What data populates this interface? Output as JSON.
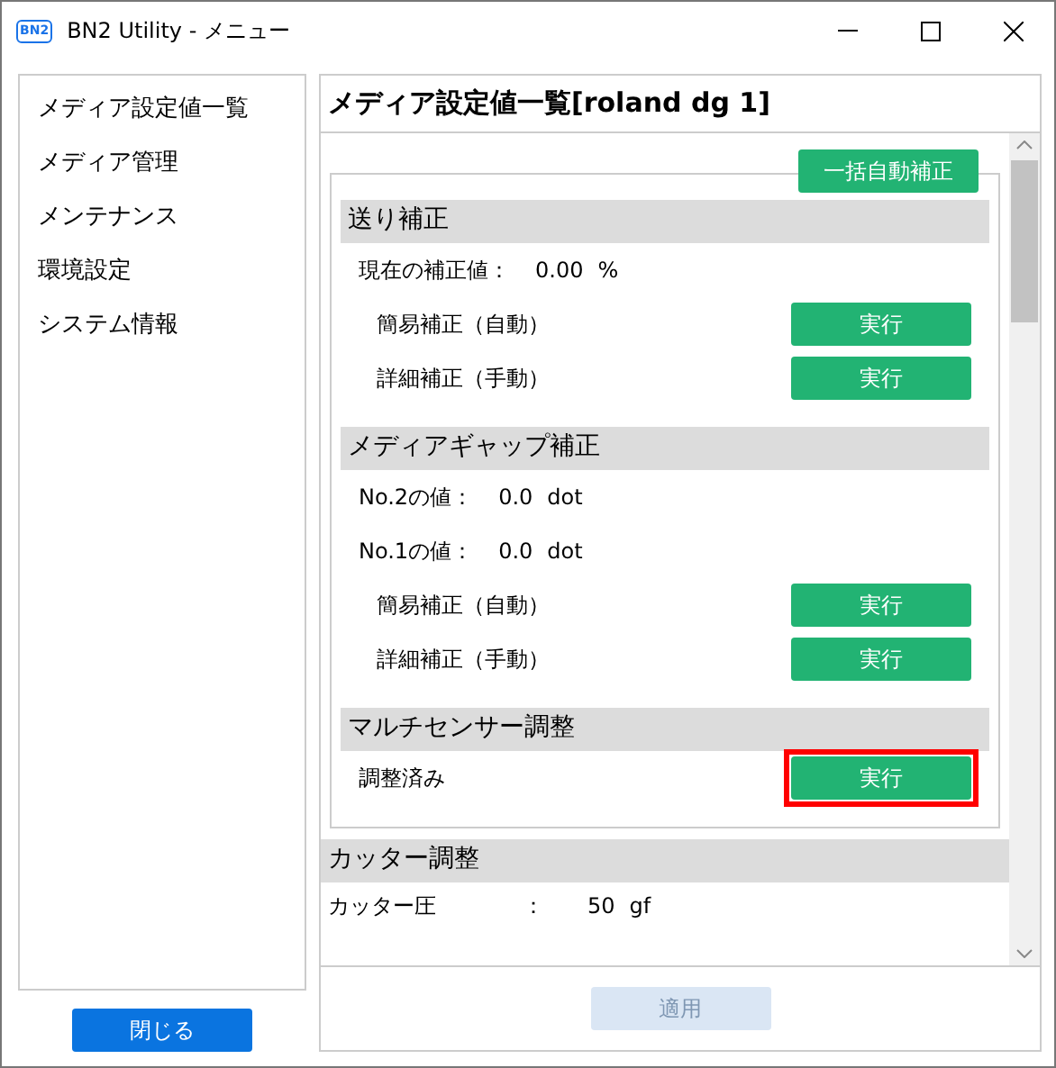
{
  "window": {
    "title": "BN2 Utility - メニュー",
    "logo": "BN2"
  },
  "sidebar": {
    "items": [
      {
        "label": "メディア設定値一覧"
      },
      {
        "label": "メディア管理"
      },
      {
        "label": "メンテナンス"
      },
      {
        "label": "環境設定"
      },
      {
        "label": "システム情報"
      }
    ],
    "close_button": "閉じる"
  },
  "content": {
    "title": "メディア設定値一覧[roland dg 1]",
    "auto_button": "一括自動補正",
    "groups": [
      {
        "title": "送り補正",
        "rows": [
          {
            "kind": "value",
            "label": "現在の補正値：",
            "value": "0.00",
            "unit": "%"
          },
          {
            "kind": "action",
            "label": "簡易補正（自動）",
            "button": "実行",
            "highlighted": false
          },
          {
            "kind": "action",
            "label": "詳細補正（手動）",
            "button": "実行",
            "highlighted": false
          }
        ]
      },
      {
        "title": "メディアギャップ補正",
        "rows": [
          {
            "kind": "value",
            "label": "No.2の値：",
            "value": "0.0",
            "unit": "dot"
          },
          {
            "kind": "value",
            "label": "No.1の値：",
            "value": "0.0",
            "unit": "dot"
          },
          {
            "kind": "action",
            "label": "簡易補正（自動）",
            "button": "実行",
            "highlighted": false
          },
          {
            "kind": "action",
            "label": "詳細補正（手動）",
            "button": "実行",
            "highlighted": false
          }
        ]
      },
      {
        "title": "マルチセンサー調整",
        "rows": [
          {
            "kind": "action",
            "label": "調整済み",
            "button": "実行",
            "highlighted": true
          }
        ]
      }
    ],
    "cutter": {
      "title": "カッター調整",
      "rows": [
        {
          "label": "カッター圧",
          "sep": "：",
          "value": "50",
          "unit": "gf"
        }
      ]
    },
    "apply_button": {
      "label": "適用",
      "disabled": true
    }
  }
}
